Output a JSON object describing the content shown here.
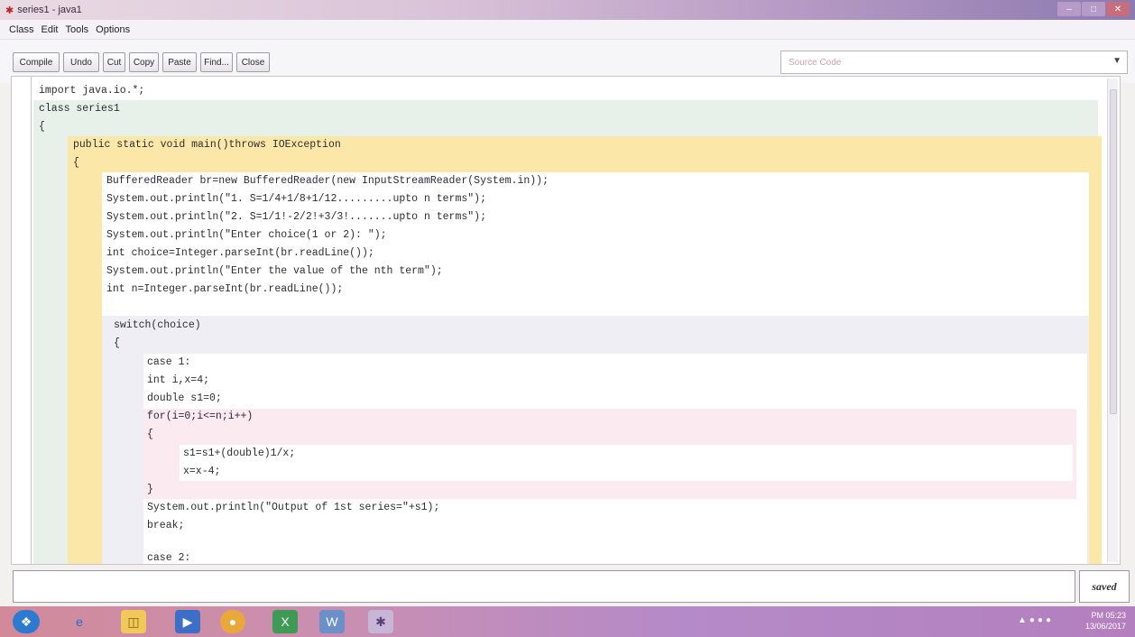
{
  "window": {
    "title": "series1 - java1"
  },
  "menu": {
    "items": [
      "Class",
      "Edit",
      "Tools",
      "Options"
    ]
  },
  "toolbar": {
    "buttons": [
      "Compile",
      "Undo",
      "Cut",
      "Copy",
      "Paste",
      "Find...",
      "Close"
    ]
  },
  "view_select": {
    "value": "Source Code"
  },
  "code": {
    "lines": [
      "import java.io.*;",
      "class series1",
      "{",
      "public static void main()throws IOException",
      "{",
      "BufferedReader br=new BufferedReader(new InputStreamReader(System.in));",
      "System.out.println(\"1. S=1/4+1/8+1/12.........upto n terms\");",
      "System.out.println(\"2. S=1/1!-2/2!+3/3!.......upto n terms\");",
      "System.out.println(\"Enter choice(1 or 2): \");",
      "int choice=Integer.parseInt(br.readLine());",
      "System.out.println(\"Enter the value of the nth term\");",
      "int n=Integer.parseInt(br.readLine());",
      "switch(choice)",
      "{",
      "case 1:",
      "int i,x=4;",
      "double s1=0;",
      "for(i=0;i<=n;i++)",
      "{",
      "s1=s1+(double)1/x;",
      "x=x-4;",
      "}",
      "System.out.println(\"Output of 1st series=\"+s1);",
      "break;",
      "case 2:"
    ]
  },
  "status": {
    "message": "",
    "saved_label": "saved"
  },
  "taskbar": {
    "time": "PM 05:23",
    "date": "13/06/2017"
  }
}
